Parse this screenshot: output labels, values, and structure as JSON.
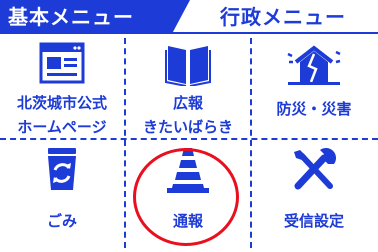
{
  "tabs": {
    "basic": "基本メニュー",
    "admin": "行政メニュー"
  },
  "menu": [
    {
      "id": "website",
      "line1": "北茨城市公式",
      "line2": "ホームページ",
      "icon": "browser-icon"
    },
    {
      "id": "pr",
      "line1": "広報",
      "line2": "きたいばらき",
      "icon": "book-icon"
    },
    {
      "id": "disaster",
      "line1": "防災・災害",
      "line2": "",
      "icon": "house-damage-icon"
    },
    {
      "id": "garbage",
      "line1": "ごみ",
      "line2": "",
      "icon": "recycle-bin-icon"
    },
    {
      "id": "report",
      "line1": "通報",
      "line2": "",
      "icon": "traffic-cone-icon"
    },
    {
      "id": "settings",
      "line1": "受信設定",
      "line2": "",
      "icon": "tools-icon"
    }
  ],
  "colors": {
    "brand": "#1d3bd6",
    "highlight": "#e8101e"
  }
}
